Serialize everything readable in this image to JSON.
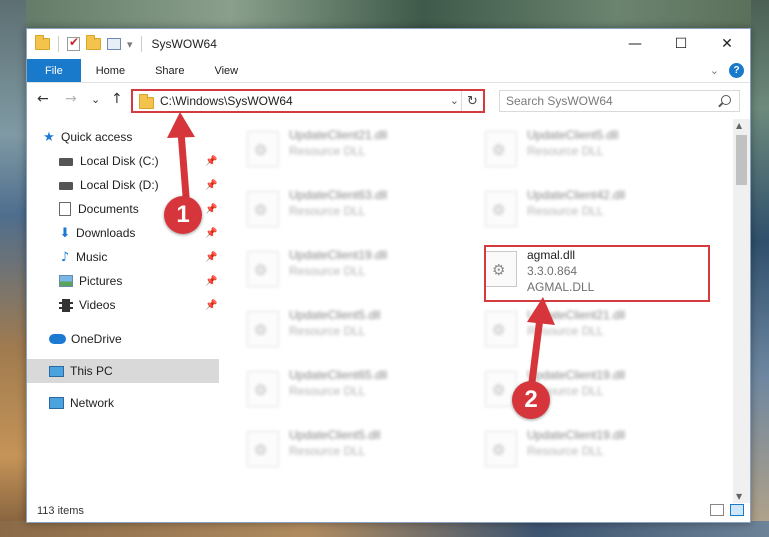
{
  "window": {
    "title": "SysWOW64",
    "controls": {
      "minimize": "—",
      "maximize": "☐",
      "close": "✕"
    }
  },
  "ribbon": {
    "tabs": [
      "File",
      "Home",
      "Share",
      "View"
    ],
    "help": "?"
  },
  "navigation": {
    "back": "←",
    "forward": "→",
    "recent": "⌄",
    "up": "↑",
    "address": "C:\\Windows\\SysWOW64",
    "search_placeholder": "Search SysWOW64"
  },
  "sidebar": {
    "items": [
      {
        "label": "Quick access",
        "icon": "quick-access-star-icon"
      },
      {
        "label": "Local Disk (C:)",
        "icon": "drive-icon",
        "pinned": true
      },
      {
        "label": "Local Disk (D:)",
        "icon": "drive-icon",
        "pinned": true
      },
      {
        "label": "Documents",
        "icon": "documents-icon",
        "pinned": true
      },
      {
        "label": "Downloads",
        "icon": "downloads-icon",
        "pinned": true
      },
      {
        "label": "Music",
        "icon": "music-icon",
        "pinned": true
      },
      {
        "label": "Pictures",
        "icon": "pictures-icon",
        "pinned": true
      },
      {
        "label": "Videos",
        "icon": "videos-icon",
        "pinned": true
      },
      {
        "label": "OneDrive",
        "icon": "onedrive-icon"
      },
      {
        "label": "This PC",
        "icon": "this-pc-icon",
        "selected": true
      },
      {
        "label": "Network",
        "icon": "network-icon"
      }
    ]
  },
  "files": [
    {
      "name": "UpdateClient21.dll",
      "sub": "Resource DLL",
      "blurred": true
    },
    {
      "name": "UpdateClient5.dll",
      "sub": "Resource DLL",
      "blurred": true
    },
    {
      "name": "UpdateClient63.dll",
      "sub": "Resource DLL",
      "blurred": true
    },
    {
      "name": "UpdateClient42.dll",
      "sub": "Resource DLL",
      "blurred": true
    },
    {
      "name": "UpdateClient19.dll",
      "sub": "Resource DLL",
      "blurred": true
    },
    {
      "name": "agmal.dll",
      "sub": "3.3.0.864",
      "sub2": "AGMAL.DLL",
      "blurred": false
    },
    {
      "name": "UpdateClient5.dll",
      "sub": "Resource DLL",
      "blurred": true
    },
    {
      "name": "UpdateClient21.dll",
      "sub": "Resource DLL",
      "blurred": true
    },
    {
      "name": "UpdateClient65.dll",
      "sub": "Resource DLL",
      "blurred": true
    },
    {
      "name": "UpdateClient19.dll",
      "sub": "Resource DLL",
      "blurred": true
    },
    {
      "name": "UpdateClient5.dll",
      "sub": "Resource DLL",
      "blurred": true
    },
    {
      "name": "UpdateClient19.dll",
      "sub": "Resource DLL",
      "blurred": true
    }
  ],
  "status": {
    "item_count": "113 items"
  },
  "callouts": {
    "one": "1",
    "two": "2"
  },
  "colors": {
    "accent": "#1979ca",
    "highlight": "#d33b3f"
  }
}
